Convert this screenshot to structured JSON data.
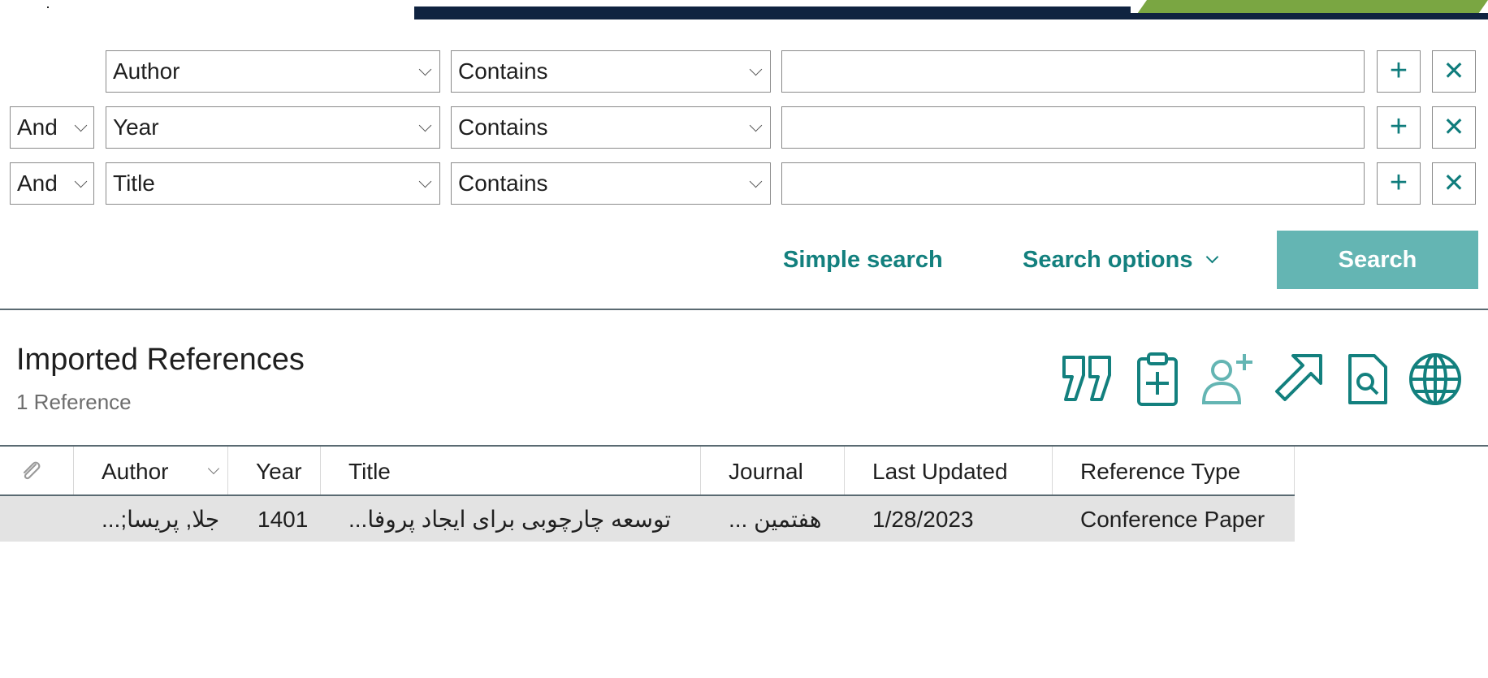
{
  "search": {
    "rows": [
      {
        "connector": "",
        "field": "Author",
        "operator": "Contains",
        "value": ""
      },
      {
        "connector": "And",
        "field": "Year",
        "operator": "Contains",
        "value": ""
      },
      {
        "connector": "And",
        "field": "Title",
        "operator": "Contains",
        "value": ""
      }
    ],
    "add_symbol": "+",
    "remove_symbol": "✕",
    "simple_search_label": "Simple search",
    "search_options_label": "Search options",
    "search_button_label": "Search"
  },
  "section": {
    "title": "Imported References",
    "count": "1 Reference"
  },
  "toolbar": {
    "icons": [
      "quote-icon",
      "clipboard-add-icon",
      "add-user-icon",
      "share-arrow-icon",
      "find-pdf-icon",
      "globe-icon"
    ],
    "accent": "#13807e"
  },
  "table": {
    "headers": {
      "attachment": "",
      "author": "Author",
      "year": "Year",
      "title": "Title",
      "journal": "Journal",
      "last_updated": "Last Updated",
      "reference_type": "Reference Type"
    },
    "rows": [
      {
        "author": "...;جلا, پریسا",
        "year": "1401",
        "title": "...توسعه چارچوبی برای ایجاد پروفا",
        "journal": "... هفتمین",
        "last_updated": "1/28/2023",
        "reference_type": "Conference Paper"
      }
    ]
  },
  "colors": {
    "top_bar": "#0f2340",
    "teal": "#13807e",
    "search_button": "#64b5b3",
    "selected_row": "#e3e3e3"
  }
}
